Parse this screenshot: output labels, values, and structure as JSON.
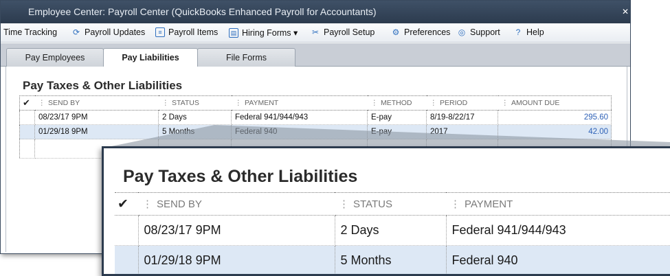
{
  "window": {
    "title": "Employee Center: Payroll Center (QuickBooks Enhanced Payroll for Accountants)"
  },
  "toolbar": {
    "items": [
      {
        "label": "Time Tracking",
        "icon": ""
      },
      {
        "label": "Payroll Updates",
        "icon": "refresh-icon"
      },
      {
        "label": "Payroll Items",
        "icon": "list-icon"
      },
      {
        "label": "Hiring Forms ▾",
        "icon": "form-icon"
      },
      {
        "label": "Payroll Setup",
        "icon": "tools-icon"
      },
      {
        "label": "Preferences",
        "icon": "gear-icon"
      },
      {
        "label": "Support",
        "icon": "lifebuoy-icon"
      },
      {
        "label": "Help",
        "icon": "help-icon"
      }
    ]
  },
  "tabs": [
    {
      "label": "Pay Employees",
      "active": false
    },
    {
      "label": "Pay Liabilities",
      "active": true
    },
    {
      "label": "File Forms",
      "active": false
    }
  ],
  "section": {
    "title": "Pay Taxes & Other Liabilities"
  },
  "liabilities": {
    "check_header": "✔",
    "columns": [
      "SEND BY",
      "STATUS",
      "PAYMENT",
      "METHOD",
      "PERIOD",
      "AMOUNT DUE"
    ],
    "rows": [
      {
        "send_by": "08/23/17 9PM",
        "status": "2 Days",
        "payment": "Federal 941/944/943",
        "method": "E-pay",
        "period": "8/19-8/22/17",
        "amount": "295.60",
        "selected": false
      },
      {
        "send_by": "01/29/18 9PM",
        "status": "5 Months",
        "payment": "Federal 940",
        "method": "E-pay",
        "period": "2017",
        "amount": "42.00",
        "selected": true
      }
    ]
  },
  "zoom": {
    "title": "Pay Taxes & Other Liabilities",
    "columns": [
      "SEND BY",
      "STATUS",
      "PAYMENT"
    ],
    "rows": [
      {
        "send_by": "08/23/17 9PM",
        "status": "2 Days",
        "payment": "Federal 941/944/943"
      },
      {
        "send_by": "01/29/18 9PM",
        "status": "5 Months",
        "payment": "Federal 940"
      }
    ]
  },
  "colors": {
    "titlebar": "#2c3b4e",
    "amount": "#2f62b7",
    "selected_row": "#dde8f5"
  }
}
